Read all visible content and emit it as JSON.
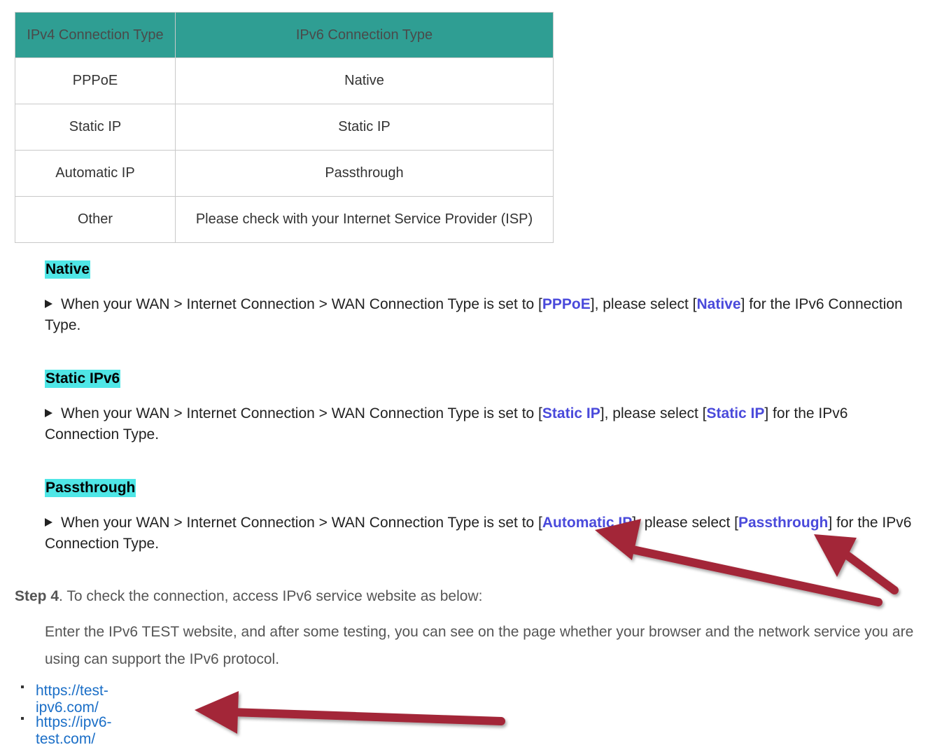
{
  "table": {
    "headers": [
      "IPv4 Connection Type",
      "IPv6 Connection Type"
    ],
    "rows": [
      [
        "PPPoE",
        "Native"
      ],
      [
        "Static IP",
        "Static IP"
      ],
      [
        "Automatic IP",
        "Passthrough"
      ],
      [
        "Other",
        "Please check with your Internet Service Provider (ISP)"
      ]
    ]
  },
  "sections": [
    {
      "title": "Native",
      "prefix": "When your WAN > Internet Connection > WAN Connection Type is set to [",
      "wan_type": "PPPoE",
      "middle": "], please select [",
      "ipv6_type": "Native",
      "suffix": "] for the IPv6 Connection Type."
    },
    {
      "title": "Static IPv6",
      "prefix": "When your WAN > Internet Connection > WAN Connection Type is set to [",
      "wan_type": "Static IP",
      "middle": "], please select [",
      "ipv6_type": "Static IP",
      "suffix": "] for the IPv6 Connection Type."
    },
    {
      "title": "Passthrough",
      "prefix": "When your WAN > Internet Connection > WAN Connection Type is set to [",
      "wan_type": "Automatic IP",
      "middle": "], please select [",
      "ipv6_type": "Passthrough",
      "suffix": "] for the IPv6 Connection Type."
    }
  ],
  "step": {
    "label": "Step 4",
    "text": ". To check the connection, access IPv6 service website as below:",
    "description": "Enter the IPv6 TEST website, and after some testing, you can see on the page whether your browser and the network service you are using can support the IPv6 protocol."
  },
  "links": [
    "https://test-ipv6.com/",
    "https://ipv6-test.com/"
  ],
  "colors": {
    "header_bg": "#2f9e93",
    "highlight": "#4fe6e6",
    "link_bold": "#4a4adb",
    "url_link": "#1a6ec7",
    "annotation_arrow": "#a32838"
  }
}
